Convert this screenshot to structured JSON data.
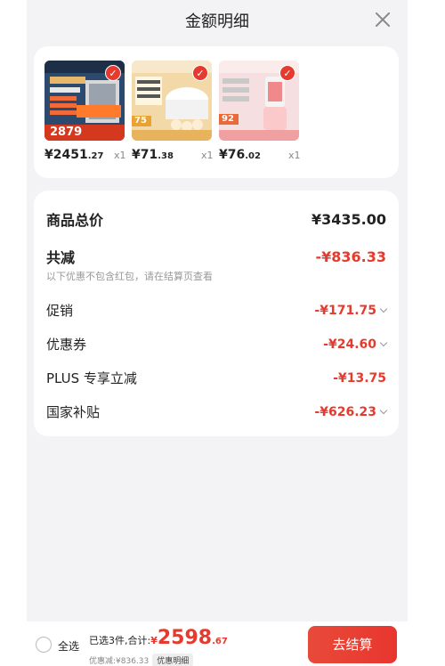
{
  "header": {
    "title": "金额明细"
  },
  "products": [
    {
      "price_int": "¥2451",
      "price_dec": ".27",
      "qty": "x1",
      "badge": "2879"
    },
    {
      "price_int": "¥71",
      "price_dec": ".38",
      "qty": "x1",
      "badge": "75"
    },
    {
      "price_int": "¥76",
      "price_dec": ".02",
      "qty": "x1",
      "badge": "92"
    }
  ],
  "summary": {
    "total_label": "商品总价",
    "total_value": "¥3435.00",
    "reduce_label": "共减",
    "reduce_value": "-¥836.33",
    "note": "以下优惠不包含红包，请在结算页查看",
    "items": [
      {
        "label": "促销",
        "value": "-¥171.75"
      },
      {
        "label": "优惠券",
        "value": "-¥24.60"
      },
      {
        "label": "PLUS 专享立减",
        "value": "-¥13.75"
      },
      {
        "label": "国家补贴",
        "value": "-¥626.23"
      }
    ]
  },
  "bottom": {
    "select_all": "全选",
    "selected_text": "已选3件,合计:",
    "total_yen": "¥",
    "total_int": "2598",
    "total_dec": ".67",
    "discount_text": "优惠减:¥836.33",
    "detail_label": "优惠明细",
    "checkout_label": "去结算"
  },
  "colors": {
    "accent": "#e63a2e",
    "sheet_bg": "#f3f3f5"
  }
}
